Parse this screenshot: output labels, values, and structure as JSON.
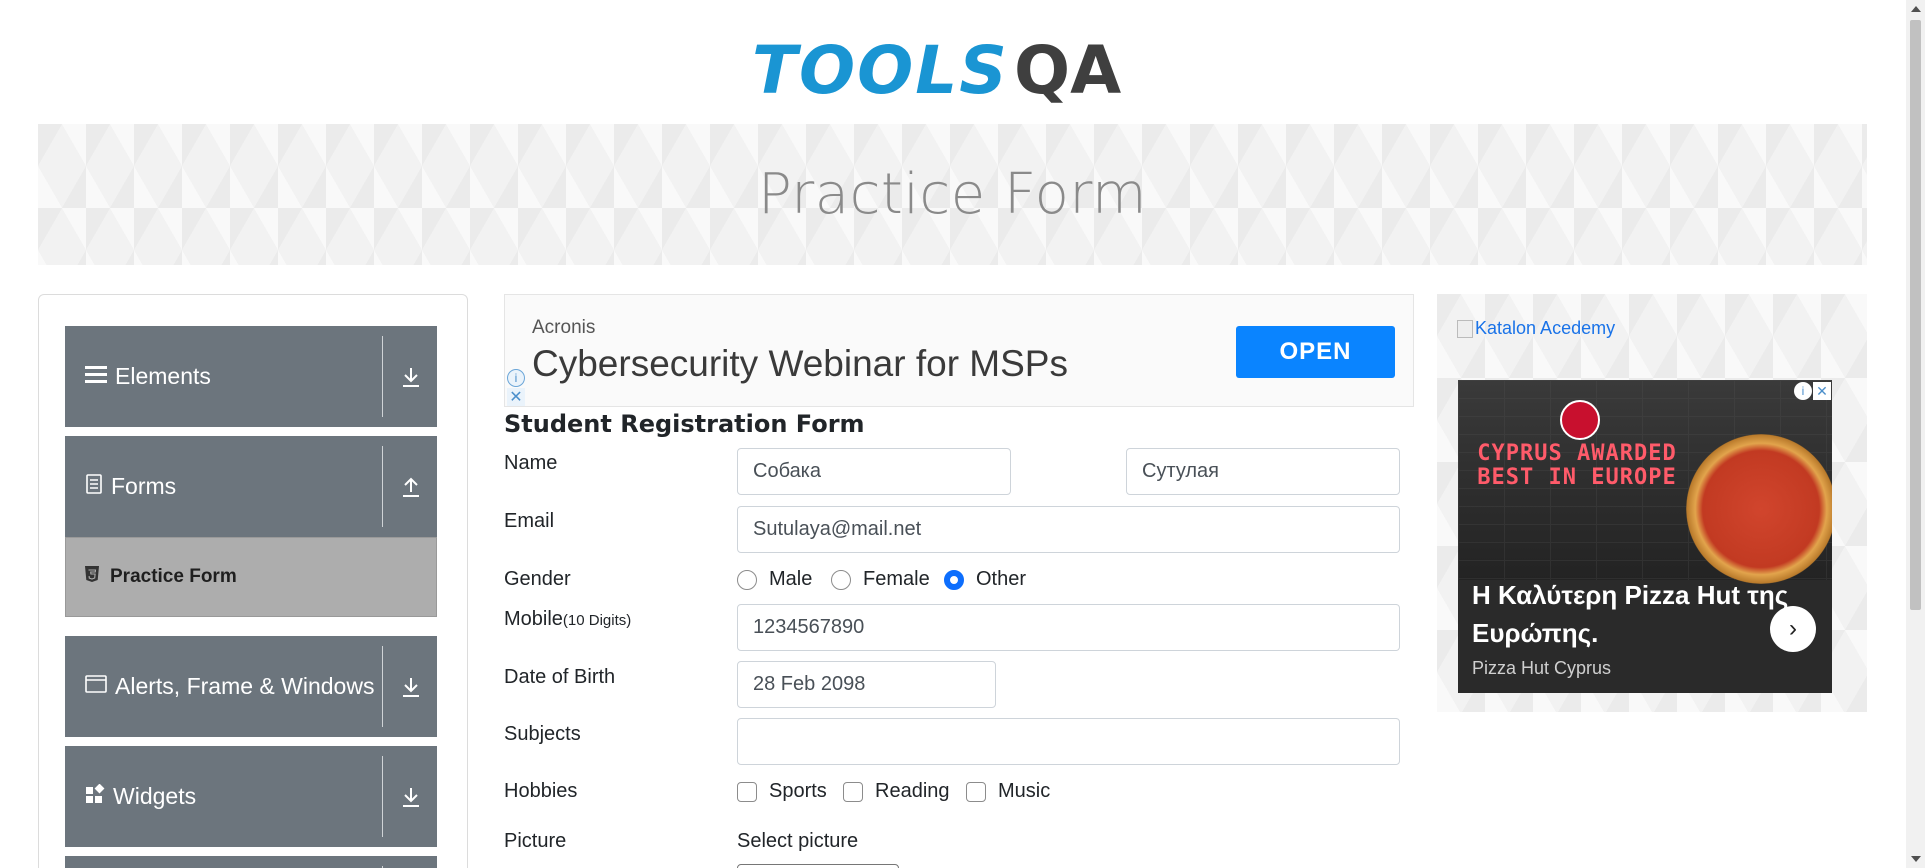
{
  "logo": {
    "text_tools": "TOOLS",
    "text_qa": "QA"
  },
  "banner": {
    "title": "Practice Form"
  },
  "sidebar": {
    "groups": [
      {
        "label": "Elements",
        "icon": "menu-icon",
        "arrow": "download-icon"
      },
      {
        "label": "Forms",
        "icon": "document-icon",
        "arrow": "upload-icon"
      },
      {
        "label": "Alerts, Frame & Windows",
        "icon": "window-icon",
        "arrow": "download-icon"
      },
      {
        "label": "Widgets",
        "icon": "widgets-icon",
        "arrow": "download-icon"
      }
    ],
    "active_item": {
      "label": "Practice Form",
      "icon": "html5-icon"
    }
  },
  "ad_top": {
    "brand": "Acronis",
    "headline": "Cybersecurity Webinar for MSPs",
    "button": "OPEN"
  },
  "form": {
    "title": "Student Registration Form",
    "name_label": "Name",
    "first_name": "Собака",
    "last_name": "Сутулая",
    "email_label": "Email",
    "email": "Sutulaya@mail.net",
    "gender_label": "Gender",
    "gender_options": [
      "Male",
      "Female",
      "Other"
    ],
    "gender_selected": "Other",
    "mobile_label": "Mobile",
    "mobile_hint": "(10 Digits)",
    "mobile": "1234567890",
    "dob_label": "Date of Birth",
    "dob": "28 Feb 2098",
    "subjects_label": "Subjects",
    "subjects": "",
    "hobbies_label": "Hobbies",
    "hobbies": [
      "Sports",
      "Reading",
      "Music"
    ],
    "picture_label": "Picture",
    "picture_button": "Select picture"
  },
  "ad_right": {
    "broken_image_alt": "Katalon Acedemy",
    "promo_text": "CYPRUS AWARDED BEST IN EUROPE",
    "caption": "Η Καλύτερη Pizza Hut της Ευρώπης.",
    "sponsor": "Pizza Hut Cyprus"
  },
  "colors": {
    "primary": "#0d6efd",
    "sidebar": "#6c757d",
    "logo_blue": "#1a95d3",
    "ad_button": "#0a84ff"
  }
}
